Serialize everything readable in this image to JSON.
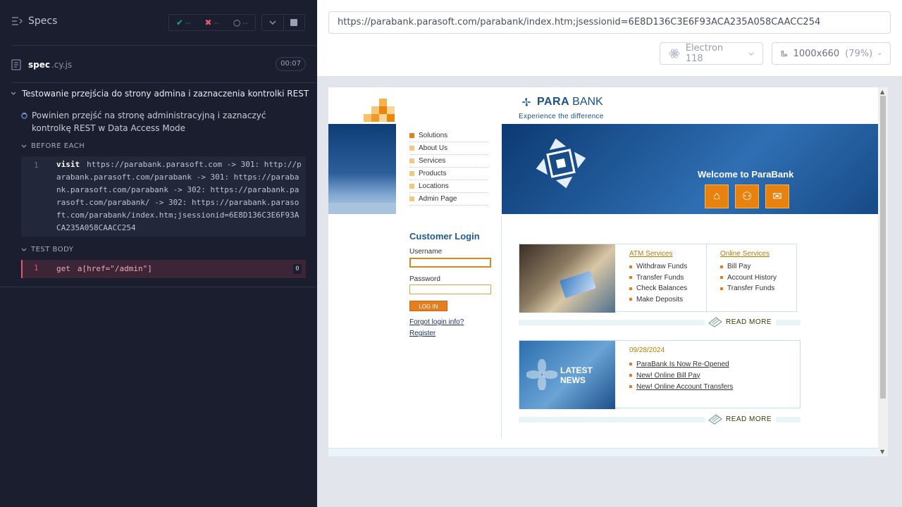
{
  "reporter": {
    "title": "Specs",
    "stats": {
      "passed": "--",
      "failed": "--",
      "pending": "--"
    },
    "spec": {
      "name": "spec",
      "ext": ".cy.js",
      "duration": "00:07"
    },
    "suite_title": "Testowanie przejścia do strony admina i zaznaczenia kontrolki REST",
    "test_title": "Powinien przejść na stronę administracyjną i zaznaczyć kontrolkę REST w Data Access Mode",
    "before_each": {
      "label": "BEFORE EACH",
      "cmd_num": "1",
      "cmd_name": "visit",
      "cmd_text": "https://parabank.parasoft.com -> 301: http://parabank.parasoft.com/parabank -> 301: https://parabank.parasoft.com/parabank -> 302: https://parabank.parasoft.com/parabank/ -> 302: https://parabank.parasoft.com/parabank/index.htm;jsessionid=6E8D136C3E6F93ACA235A058CAACC254"
    },
    "test_body": {
      "label": "TEST BODY",
      "cmd_num": "1",
      "cmd_name": "get",
      "cmd_text": "a[href=\"/admin\"]",
      "badge": "0"
    }
  },
  "aut": {
    "url": "https://parabank.parasoft.com/parabank/index.htm;jsessionid=6E8D136C3E6F93ACA235A058CAACC254",
    "browser": "Electron 118",
    "viewport": "1000x660",
    "zoom": "(79%)"
  },
  "parabank": {
    "brand_bold": "PARA",
    "brand_rest": "BANK",
    "tagline": "Experience the difference",
    "menu": [
      "Solutions",
      "About Us",
      "Services",
      "Products",
      "Locations",
      "Admin Page"
    ],
    "welcome": "Welcome to ParaBank",
    "login": {
      "title": "Customer Login",
      "username_label": "Username",
      "password_label": "Password",
      "button": "LOG IN",
      "forgot": "Forgot login info?",
      "register": "Register"
    },
    "atm": {
      "heading": "ATM Services",
      "items": [
        "Withdraw Funds",
        "Transfer Funds",
        "Check Balances",
        "Make Deposits"
      ]
    },
    "online": {
      "heading": "Online Services",
      "items": [
        "Bill Pay",
        "Account History",
        "Transfer Funds"
      ]
    },
    "read_more": "READ MORE",
    "news": {
      "image_text_1": "LATEST",
      "image_text_2": "NEWS",
      "date": "09/28/2024",
      "items": [
        "ParaBank Is Now Re-Opened",
        "New! Online Bill Pay",
        "New! Online Account Transfers"
      ]
    }
  }
}
